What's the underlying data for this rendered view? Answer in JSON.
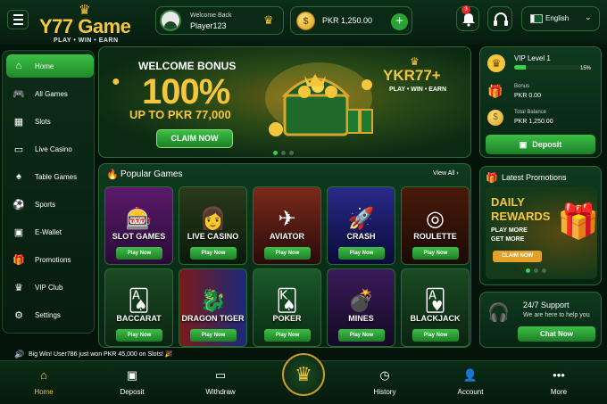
{
  "header": {
    "logo_name": "Y77 Game",
    "logo_tagline": "PLAY • WIN • EARN",
    "welcome_label": "Welcome Back",
    "username": "Player123",
    "balance": "PKR 1,250.00",
    "add_symbol": "+",
    "notification_count": "3",
    "language": "English"
  },
  "sidebar": {
    "items": [
      {
        "label": "Home",
        "icon": "home-icon"
      },
      {
        "label": "All Games",
        "icon": "gamepad-icon"
      },
      {
        "label": "Slots",
        "icon": "slots-icon"
      },
      {
        "label": "Live Casino",
        "icon": "tablet-icon"
      },
      {
        "label": "Table Games",
        "icon": "spade-icon"
      },
      {
        "label": "Sports",
        "icon": "soccer-ball-icon"
      },
      {
        "label": "E-Wallet",
        "icon": "wallet-icon"
      },
      {
        "label": "Promotions",
        "icon": "gift-icon"
      },
      {
        "label": "VIP Club",
        "icon": "crown-icon"
      },
      {
        "label": "Settings",
        "icon": "gear-icon"
      }
    ]
  },
  "banner": {
    "title": "WELCOME BONUS",
    "percent": "100%",
    "subtitle": "UP TO PKR 77,000",
    "claim": "CLAIM NOW",
    "brand": "YKR77+",
    "brand_tagline": "PLAY • WIN • EARN"
  },
  "vip": {
    "level": "VIP Level 1",
    "progress_label": "15%",
    "progress_fraction": 0.15,
    "bonus_label": "Bonus",
    "bonus_value": "PKR 0.00",
    "total_label": "Total Balance",
    "total_value": "PKR 1,250.00",
    "deposit": "Deposit"
  },
  "games": {
    "title": "Popular Games",
    "view_all": "View All",
    "play_label": "Play Now",
    "items": [
      {
        "name": "SLOT GAMES",
        "icon": "slot-machine-icon"
      },
      {
        "name": "LIVE CASINO",
        "icon": "dealer-icon"
      },
      {
        "name": "AVIATOR",
        "icon": "airplane-icon"
      },
      {
        "name": "CRASH",
        "icon": "rocket-icon"
      },
      {
        "name": "ROULETTE",
        "icon": "roulette-icon"
      },
      {
        "name": "BACCARAT",
        "icon": "cards-icon"
      },
      {
        "name": "DRAGON TIGER",
        "icon": "dragon-icon"
      },
      {
        "name": "POKER",
        "icon": "poker-cards-icon"
      },
      {
        "name": "MINES",
        "icon": "bomb-icon"
      },
      {
        "name": "BLACKJACK",
        "icon": "blackjack-icon"
      }
    ]
  },
  "promotions": {
    "title": "Latest Promotions",
    "card_title_1": "DAILY",
    "card_title_2": "REWARDS",
    "card_sub_1": "PLAY MORE",
    "card_sub_2": "GET MORE",
    "card_claim": "CLAIM NOW"
  },
  "support": {
    "title": "24/7 Support",
    "subtitle": "We are here to help you",
    "chat": "Chat Now"
  },
  "ticker": {
    "text": "Big Win! User786 just won PKR 45,000 on Slots! 🎉"
  },
  "nav": {
    "items": [
      {
        "label": "Home",
        "icon": "home-icon"
      },
      {
        "label": "Deposit",
        "icon": "deposit-icon"
      },
      {
        "label": "Withdraw",
        "icon": "withdraw-icon"
      },
      {
        "label": "History",
        "icon": "clock-icon"
      },
      {
        "label": "Account",
        "icon": "user-icon"
      },
      {
        "label": "More",
        "icon": "more-icon"
      }
    ]
  },
  "colors": {
    "accent_green": "#3cbf46",
    "gold": "#f5c63c",
    "background": "#04140b"
  }
}
